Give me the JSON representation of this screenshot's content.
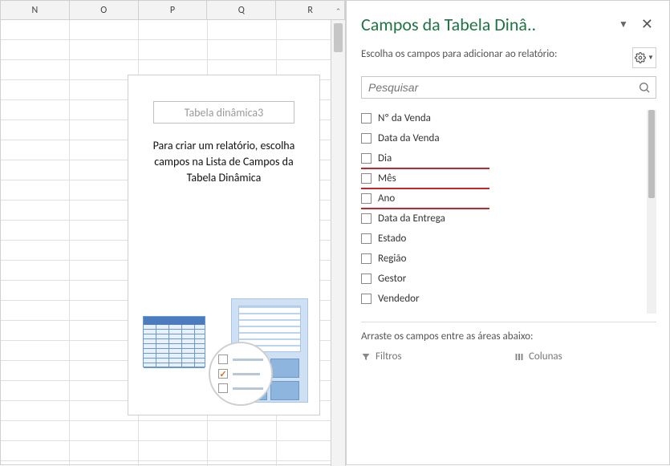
{
  "columns": [
    "N",
    "O",
    "P",
    "Q",
    "R"
  ],
  "placeholder": {
    "pivot_name": "Tabela dinâmica3",
    "instruction": "Para criar um relatório, escolha campos na Lista de Campos da Tabela Dinâmica"
  },
  "pane": {
    "title": "Campos da Tabela Dinâ..",
    "instruction": "Escolha os campos para adicionar ao relatório:",
    "search_placeholder": "Pesquisar",
    "fields": [
      {
        "label": "Nº da Venda",
        "checked": false,
        "underline": false
      },
      {
        "label": "Data da Venda",
        "checked": false,
        "underline": false
      },
      {
        "label": "Dia",
        "checked": false,
        "underline": true
      },
      {
        "label": "Mês",
        "checked": false,
        "underline": true
      },
      {
        "label": "Ano",
        "checked": false,
        "underline": true
      },
      {
        "label": "Data da Entrega",
        "checked": false,
        "underline": false
      },
      {
        "label": "Estado",
        "checked": false,
        "underline": false
      },
      {
        "label": "Região",
        "checked": false,
        "underline": false
      },
      {
        "label": "Gestor",
        "checked": false,
        "underline": false
      },
      {
        "label": "Vendedor",
        "checked": false,
        "underline": false
      }
    ],
    "drag_label": "Arraste os campos entre as áreas abaixo:",
    "areas": {
      "filters": "Filtros",
      "columns": "Colunas"
    }
  }
}
